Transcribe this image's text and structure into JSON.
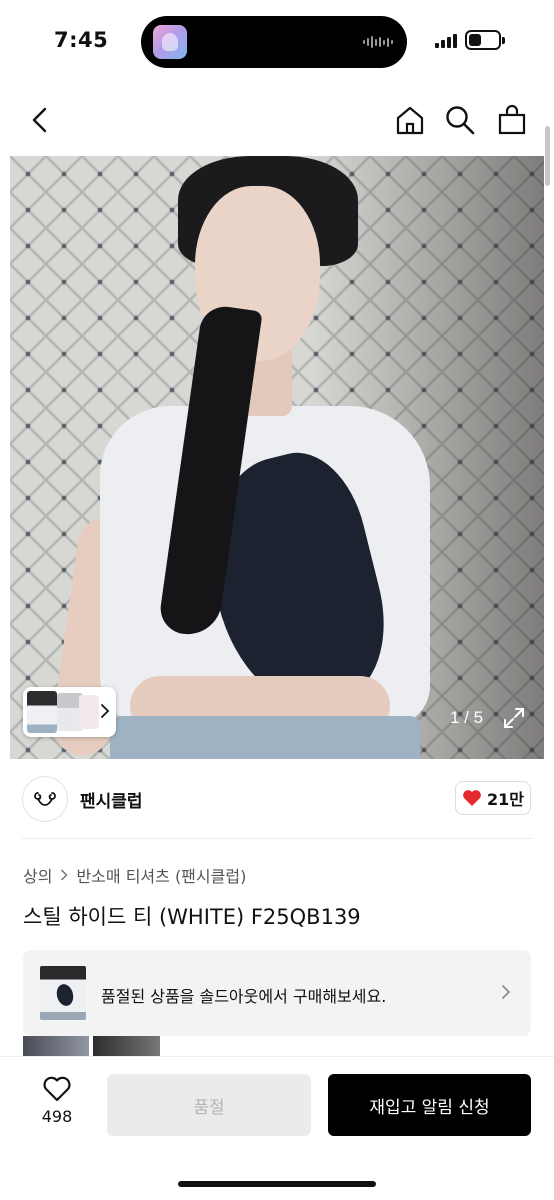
{
  "status_bar": {
    "time": "7:45",
    "icons": [
      "now-playing-icon",
      "waveform-icon",
      "cellular-signal-icon",
      "battery-icon"
    ]
  },
  "nav": {
    "icons": [
      "back-chevron-icon",
      "home-icon",
      "search-icon",
      "shopping-bag-icon"
    ]
  },
  "gallery": {
    "pager": "1 / 5",
    "icons": [
      "thumbnail-strip",
      "expand-icon"
    ]
  },
  "brand": {
    "name": "팬시클럽",
    "likes": "21만",
    "logo_icon": "fancy-club-logo-icon",
    "like_icon": "heart-filled-icon",
    "like_color": "#e52a2f"
  },
  "breadcrumb": {
    "category": "상의",
    "subcategory": "반소매 티셔츠 (팬시클럽)"
  },
  "product": {
    "title": "스틸 하이드 티 (WHITE) F25QB139"
  },
  "soldout_banner": {
    "text": "품절된 상품을 솔드아웃에서 구매해보세요."
  },
  "bottom_bar": {
    "wishlist_count": "498",
    "soldout_label": "품절",
    "restock_label": "재입고 알림 신청"
  }
}
